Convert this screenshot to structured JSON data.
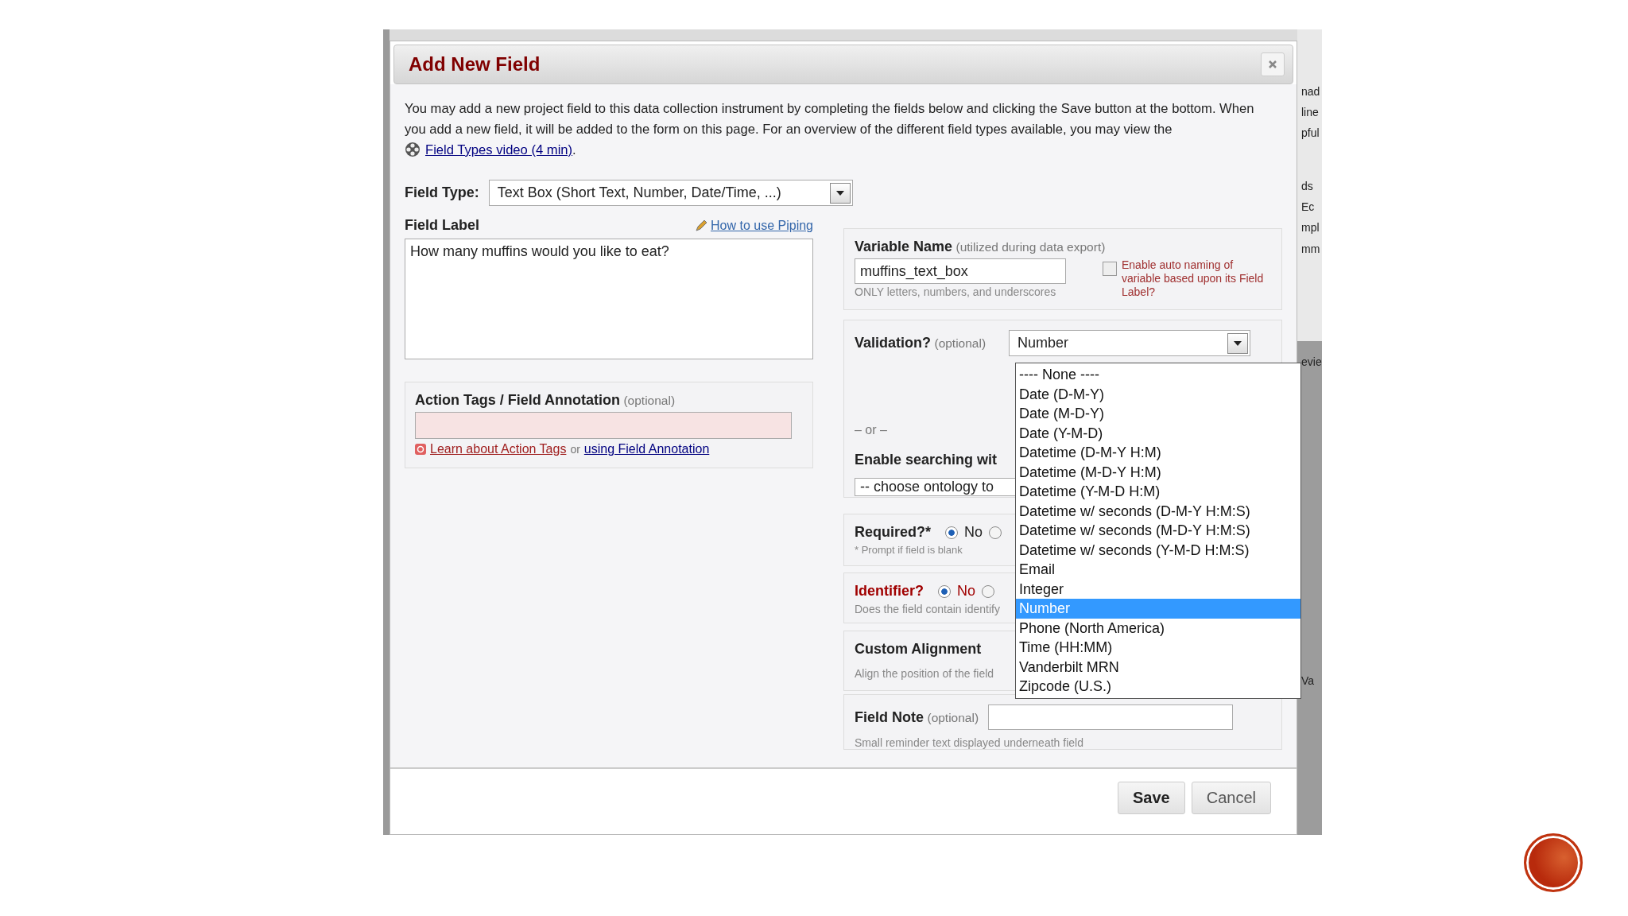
{
  "dialog": {
    "title": "Add New Field",
    "intro": "You may add a new project field to this data collection instrument by completing the fields below and clicking the Save button at the bottom. When you add a new field, it will be added to the form on this page. For an overview of the different field types available, you may view the",
    "video_link": "Field Types video (4 min)",
    "video_tail": ".",
    "field_type": {
      "label": "Field Type:",
      "value": "Text Box (Short Text, Number, Date/Time, ...)"
    },
    "field_label": {
      "label": "Field Label",
      "piping_link": "How to use Piping",
      "value": "How many muffins would you like to eat?"
    },
    "action_tags": {
      "label": "Action Tags / Field Annotation",
      "hint": "(optional)",
      "learn_link": "Learn about Action Tags",
      "or": "or",
      "annotation_link": "using Field Annotation"
    },
    "variable_name": {
      "label": "Variable Name",
      "hint": "(utilized during data export)",
      "value": "muffins_text_box",
      "help": "ONLY letters, numbers, and underscores",
      "auto_naming": {
        "label": "Enable auto naming of variable based upon its Field Label?",
        "checked": false
      }
    },
    "validation": {
      "label": "Validation?",
      "hint": "(optional)",
      "value": "Number",
      "or": "– or –",
      "ontology_label": "Enable searching wit",
      "ontology_value": "-- choose ontology to",
      "options": [
        {
          "label": "---- None ----",
          "selected": false
        },
        {
          "label": "Date (D-M-Y)",
          "selected": false
        },
        {
          "label": "Date (M-D-Y)",
          "selected": false
        },
        {
          "label": "Date (Y-M-D)",
          "selected": false
        },
        {
          "label": "Datetime (D-M-Y H:M)",
          "selected": false
        },
        {
          "label": "Datetime (M-D-Y H:M)",
          "selected": false
        },
        {
          "label": "Datetime (Y-M-D H:M)",
          "selected": false
        },
        {
          "label": "Datetime w/ seconds (D-M-Y H:M:S)",
          "selected": false
        },
        {
          "label": "Datetime w/ seconds (M-D-Y H:M:S)",
          "selected": false
        },
        {
          "label": "Datetime w/ seconds (Y-M-D H:M:S)",
          "selected": false
        },
        {
          "label": "Email",
          "selected": false
        },
        {
          "label": "Integer",
          "selected": false
        },
        {
          "label": "Number",
          "selected": true
        },
        {
          "label": "Phone (North America)",
          "selected": false
        },
        {
          "label": "Time (HH:MM)",
          "selected": false
        },
        {
          "label": "Vanderbilt MRN",
          "selected": false
        },
        {
          "label": "Zipcode (U.S.)",
          "selected": false
        }
      ]
    },
    "required": {
      "label": "Required?*",
      "options": [
        {
          "label": "No",
          "selected": true
        },
        {
          "selected": false
        }
      ],
      "help": "* Prompt if field is blank"
    },
    "identifier": {
      "label": "Identifier?",
      "options": [
        {
          "label": "No",
          "selected": true
        },
        {
          "selected": false
        }
      ],
      "help": "Does the field contain identify"
    },
    "custom_alignment": {
      "label": "Custom Alignment",
      "help": "Align the position of the field"
    },
    "field_note": {
      "label": "Field Note",
      "hint": "(optional)",
      "help": "Small reminder text displayed underneath field"
    },
    "buttons": [
      {
        "label": "Save",
        "kind": "primary"
      },
      {
        "label": "Cancel",
        "kind": "secondary"
      }
    ]
  },
  "background_page": {
    "fragments": [
      "nad",
      "line",
      "pful",
      "ds",
      "Ec",
      "mpl",
      "mm",
      "evie",
      "Va"
    ]
  }
}
